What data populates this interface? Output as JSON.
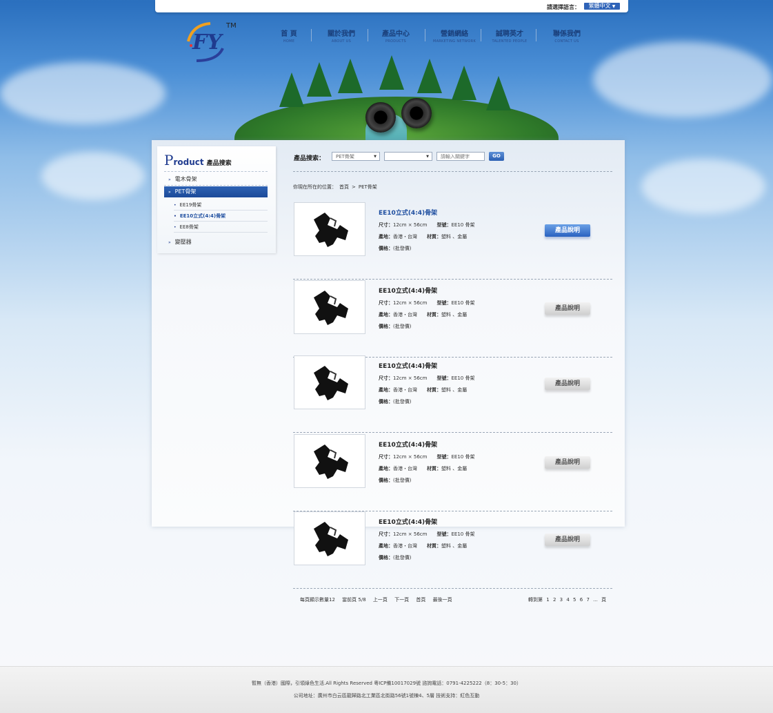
{
  "top": {
    "lang_label": "請選擇語言：",
    "lang_value": "繁體中文"
  },
  "logo": {
    "text": "FY",
    "tm": "TM"
  },
  "nav": [
    {
      "cn": "首 頁",
      "en": "HOME"
    },
    {
      "cn": "關於我們",
      "en": "ABOUT US"
    },
    {
      "cn": "產品中心",
      "en": "PRODUCTS"
    },
    {
      "cn": "營銷網絡",
      "en": "MARKETING NETWORK"
    },
    {
      "cn": "誠聘英才",
      "en": "TALENTED PEOPLE"
    },
    {
      "cn": "聯係我們",
      "en": "CONTACT US"
    }
  ],
  "sidebar": {
    "title_p": "P",
    "title_rest": "roduct",
    "title_cn": "產品搜索",
    "items": [
      {
        "label": "電木骨架"
      },
      {
        "label": "PET骨架"
      },
      {
        "label": "EE19骨架"
      },
      {
        "label": "EE10立式(4:4)骨架"
      },
      {
        "label": "EE8骨架"
      },
      {
        "label": "變壓器"
      }
    ]
  },
  "search": {
    "label": "產品搜索：",
    "select1": "PET骨架",
    "select2": "",
    "placeholder": "請輸入關鍵字",
    "go": "GO"
  },
  "breadcrumb": {
    "prefix": "你現在所在的位置：",
    "home": "首頁",
    "sep": ">",
    "current": "PET骨架"
  },
  "products": [
    {
      "title": "EE10立式(4:4)骨架",
      "size_label": "尺寸：",
      "size": "12cm × 56cm",
      "model_label": "型號：",
      "model": "EE10 骨架",
      "origin_label": "產地：",
      "origin": "香港・台灣",
      "material_label": "材質：",
      "material": "塑料 、金屬",
      "price_label": "價格：",
      "price": "(批發價)",
      "button": "產品說明"
    },
    {
      "title": "EE10立式(4:4)骨架",
      "size_label": "尺寸：",
      "size": "12cm × 56cm",
      "model_label": "型號：",
      "model": "EE10 骨架",
      "origin_label": "產地：",
      "origin": "香港・台灣",
      "material_label": "材質：",
      "material": "塑料 、金屬",
      "price_label": "價格：",
      "price": "(批發價)",
      "button": "產品說明"
    },
    {
      "title": "EE10立式(4:4)骨架",
      "size_label": "尺寸：",
      "size": "12cm × 56cm",
      "model_label": "型號：",
      "model": "EE10 骨架",
      "origin_label": "產地：",
      "origin": "香港・台灣",
      "material_label": "材質：",
      "material": "塑料 、金屬",
      "price_label": "價格：",
      "price": "(批發價)",
      "button": "產品說明"
    },
    {
      "title": "EE10立式(4:4)骨架",
      "size_label": "尺寸：",
      "size": "12cm × 56cm",
      "model_label": "型號：",
      "model": "EE10 骨架",
      "origin_label": "產地：",
      "origin": "香港・台灣",
      "material_label": "材質：",
      "material": "塑料 、金屬",
      "price_label": "價格：",
      "price": "(批發價)",
      "button": "產品說明"
    },
    {
      "title": "EE10立式(4:4)骨架",
      "size_label": "尺寸：",
      "size": "12cm × 56cm",
      "model_label": "型號：",
      "model": "EE10 骨架",
      "origin_label": "產地：",
      "origin": "香港・台灣",
      "material_label": "材質：",
      "material": "塑料 、金屬",
      "price_label": "價格：",
      "price": "(批發價)",
      "button": "產品說明"
    }
  ],
  "pager": {
    "per_page": "每頁顯示數量12",
    "current": "當前頁 5/8",
    "prev": "上一頁",
    "next": "下一頁",
    "first": "首頁",
    "last": "最後一頁",
    "jump_label": "轉到第",
    "pages": [
      "1",
      "2",
      "3",
      "4",
      "5",
      "6",
      "7",
      "..."
    ],
    "jump_suffix": "頁"
  },
  "footer": {
    "line1": "暫無（香港）國際，引領綠色生活.All Rights Reserved 粵ICP備10017029號  諮詢電話：0791-4225222（8：30-5：30）",
    "line2": "公司地址：廣州市白云區龍歸路北工業區北街路56號1號棟4、5層 技術支持：紅色互動"
  },
  "colors": {
    "brand_blue": "#1f3b8f",
    "active_blue": "#2e63b4",
    "button_blue": "#2a62c0"
  }
}
